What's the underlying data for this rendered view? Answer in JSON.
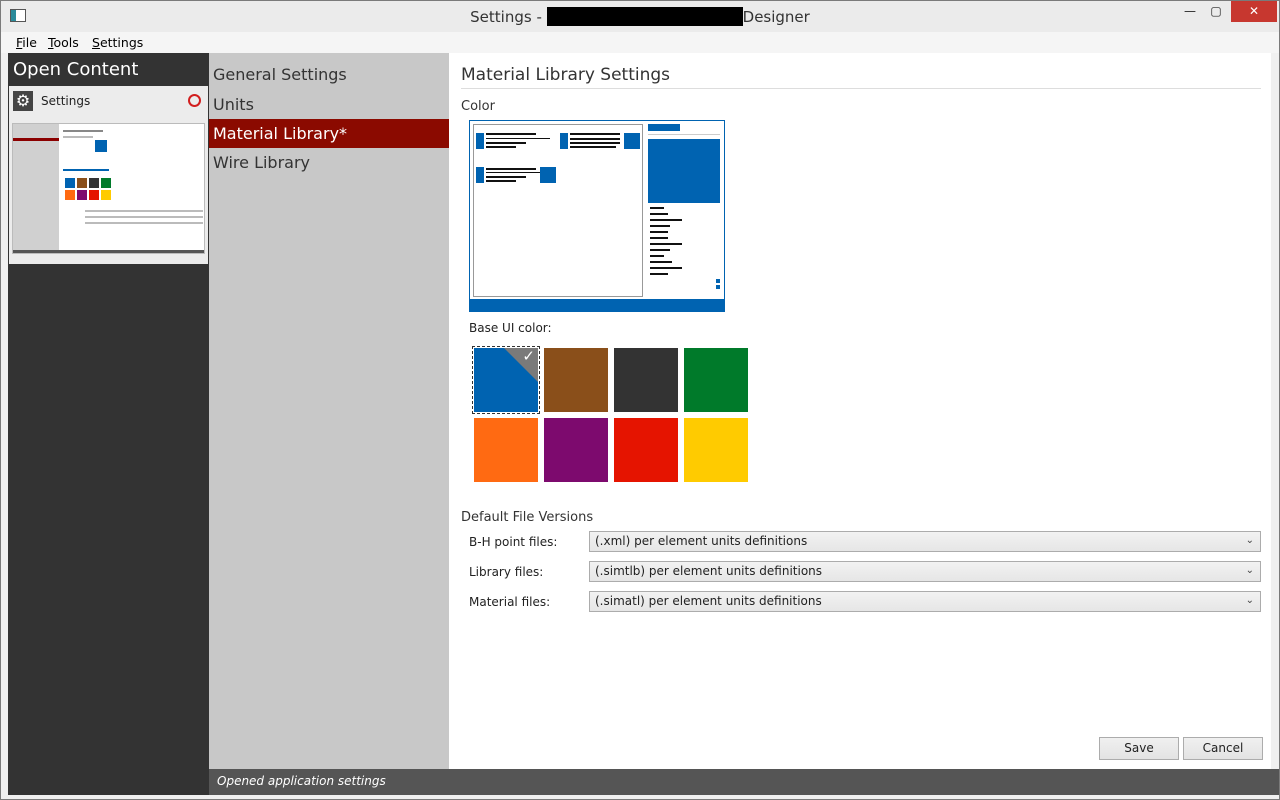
{
  "window": {
    "title_prefix": "Settings - ",
    "title_suffix": "Designer",
    "controls": {
      "minimize": "—",
      "maximize": "▢",
      "close": "✕"
    }
  },
  "menu": [
    "File",
    "Tools",
    "Settings"
  ],
  "left_panel": {
    "title": "Open Content",
    "card": {
      "label": "Settings",
      "icon": "gear-icon",
      "close_icon": "close-circle-icon"
    }
  },
  "nav": {
    "items": [
      "General Settings",
      "Units",
      "Material Library*",
      "Wire Library"
    ],
    "selected_index": 2,
    "selected_color": "#8b0a00"
  },
  "main": {
    "title": "Material Library Settings",
    "color_label": "Color",
    "base_ui_label": "Base UI color:",
    "swatches": [
      {
        "color": "#0063b1",
        "selected": true
      },
      {
        "color": "#8a4f1a",
        "selected": false
      },
      {
        "color": "#333333",
        "selected": false
      },
      {
        "color": "#007a2a",
        "selected": false
      },
      {
        "color": "#ff6a12",
        "selected": false
      },
      {
        "color": "#7d0a6e",
        "selected": false
      },
      {
        "color": "#e51400",
        "selected": false
      },
      {
        "color": "#ffcb00",
        "selected": false
      }
    ],
    "file_versions_label": "Default File Versions",
    "file_rows": [
      {
        "label": "B-H point files:",
        "value": "(.xml) per element units definitions"
      },
      {
        "label": "Library files:",
        "value": "(.simtlb) per element units definitions"
      },
      {
        "label": "Material files:",
        "value": "(.simatl) per element units definitions"
      }
    ],
    "save_label": "Save",
    "cancel_label": "Cancel"
  },
  "status": {
    "text": "Opened application settings"
  },
  "accent_color": "#0063b1"
}
